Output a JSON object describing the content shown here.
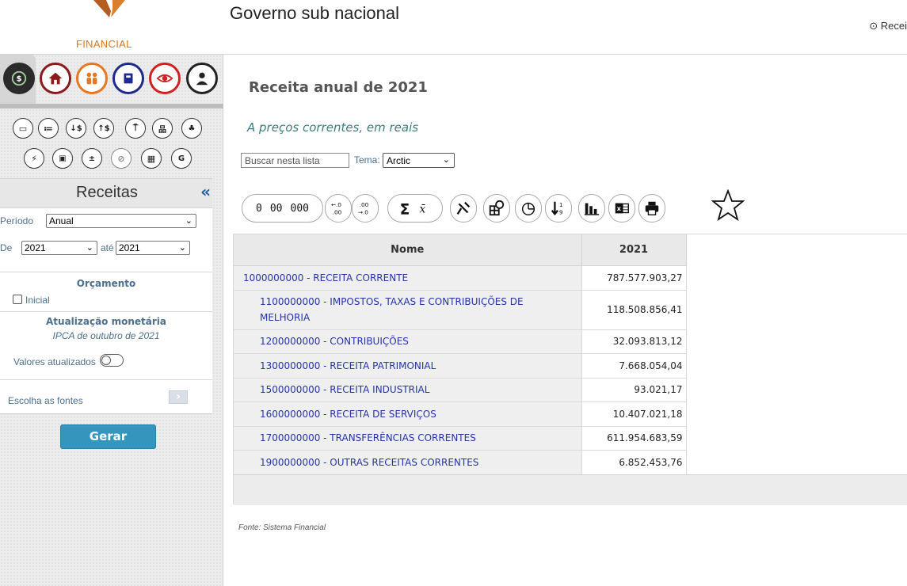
{
  "header": {
    "logo_text": "FINANCIAL",
    "title": "Governo sub nacional",
    "recent_label": "⊙ Recei"
  },
  "sidebar": {
    "top_icons": [
      "money-cycle-icon",
      "home-icon",
      "people-icon",
      "book-icon",
      "eye-icon",
      "user-icon"
    ],
    "small_icons": [
      "screen-icon",
      "list-icon",
      "down-money-icon",
      "up-money-icon",
      "signpost-icon",
      "hierarchy-icon",
      "org-chart-icon",
      "plug-icon",
      "id-card-icon",
      "calculator-icon",
      "satellite-icon",
      "calendar-icon",
      "g-icon"
    ],
    "panel_title": "Receitas",
    "collapse_label": "«",
    "periodo_label": "Período",
    "periodo_value": "Anual",
    "de_label": "De",
    "de_value": "2021",
    "ate_label": "até",
    "ate_value": "2021",
    "orcamento_label": "Orçamento",
    "inicial_label": "Inicial",
    "atualizacao_label": "Atualização monetária",
    "ipca_label": "IPCA de outubro de 2021",
    "valores_label": "Valores atualizados",
    "fontes_label": "Escolha as fontes",
    "fontes_arrow": "›",
    "gerar_label": "Gerar"
  },
  "main": {
    "title": "Receita anual de 2021",
    "subtitle": "A preços correntes, em reais",
    "search_placeholder": "Buscar nesta lista",
    "tema_label": "Tema:",
    "tema_value": "Arctic",
    "format_buttons": [
      "0",
      "00",
      "000"
    ],
    "table": {
      "headers": [
        "Nome",
        "2021"
      ],
      "rows": [
        {
          "nome": "1000000000 - RECEITA CORRENTE",
          "valor": "787.577.903,27"
        },
        {
          "nome": "1100000000 - IMPOSTOS, TAXAS E CONTRIBUIÇÕES DE MELHORIA",
          "valor": "118.508.856,41"
        },
        {
          "nome": "1200000000 - CONTRIBUIÇÕES",
          "valor": "32.093.813,12"
        },
        {
          "nome": "1300000000 - RECEITA PATRIMONIAL",
          "valor": "7.668.054,04"
        },
        {
          "nome": "1500000000 - RECEITA INDUSTRIAL",
          "valor": "93.021,17"
        },
        {
          "nome": "1600000000 - RECEITA DE SERVIÇOS",
          "valor": "10.407.021,18"
        },
        {
          "nome": "1700000000 - TRANSFERÊNCIAS CORRENTES",
          "valor": "611.954.683,59"
        },
        {
          "nome": "1900000000 - OUTRAS RECEITAS CORRENTES",
          "valor": "6.852.453,76"
        }
      ]
    },
    "fonte": "Fonte: Sistema Financial"
  },
  "colors": {
    "accent_blue": "#3595bd",
    "link_blue": "#2632a8",
    "logo_orange": "#d7761f"
  }
}
